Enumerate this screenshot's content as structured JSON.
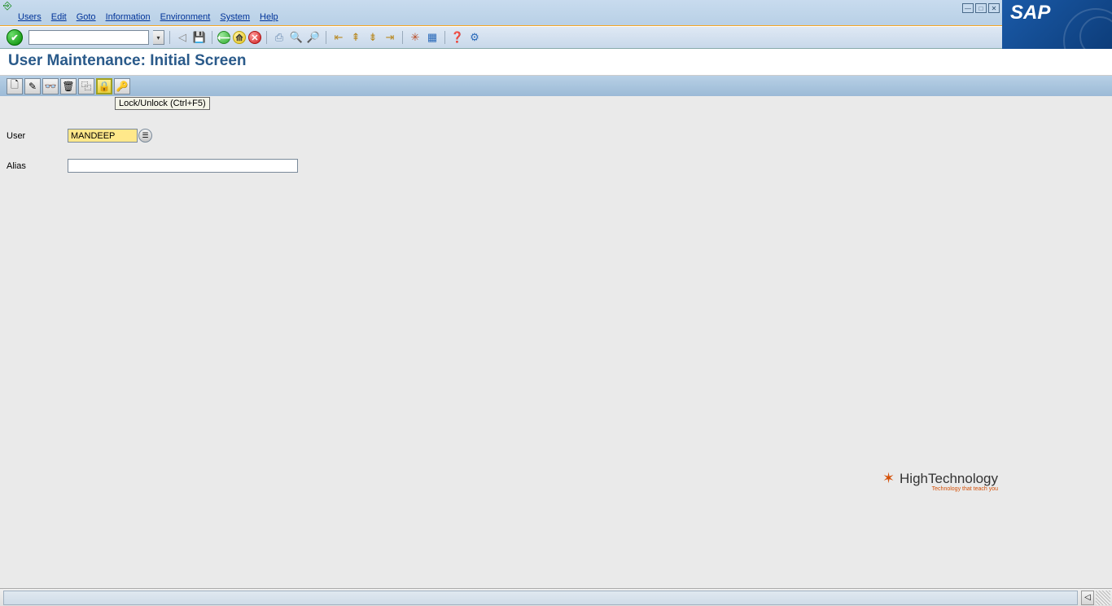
{
  "menu": {
    "users": "Users",
    "edit": "Edit",
    "goto": "Goto",
    "information": "Information",
    "environment": "Environment",
    "system": "System",
    "help": "Help"
  },
  "title": "User Maintenance: Initial Screen",
  "tooltip": "Lock/Unlock   (Ctrl+F5)",
  "form": {
    "user_label": "User",
    "user_value": "MANDEEP",
    "alias_label": "Alias",
    "alias_value": ""
  },
  "watermark": {
    "text": "HighTechnology",
    "sub": "Technology that teach you"
  },
  "brand": "SAP"
}
